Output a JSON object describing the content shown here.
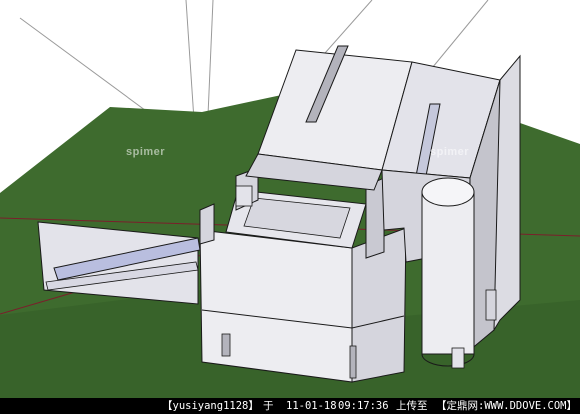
{
  "colors": {
    "background": "#ffffff",
    "grass": "#3e6b2e",
    "grass_dark": "#2f5623",
    "wall_light": "#ededf1",
    "wall_mid": "#d5d5dd",
    "wall_dark": "#b3b3bc",
    "ramp_blue": "#b9bedf",
    "edge": "#1a1a1a",
    "axis_red": "#7a1f2b",
    "axis_guide": "#9a9a9a",
    "watermark_bg": "#000000",
    "watermark_text": "#ffffff"
  },
  "scene": {
    "objects": [
      "grass-ground",
      "main-building",
      "cylinder-tower",
      "entrance-ramp",
      "glass-wall",
      "roof-skylight",
      "roof-parapet"
    ]
  },
  "faint_watermarks": [
    "spimer",
    "spimer"
  ],
  "footer": {
    "user": "【yusiyang1128】",
    "at": "于",
    "date": "11-01-18",
    "time": "09:17:36",
    "action": "上传至",
    "site": "【定鼎网:WWW.DDOVE.COM】"
  }
}
